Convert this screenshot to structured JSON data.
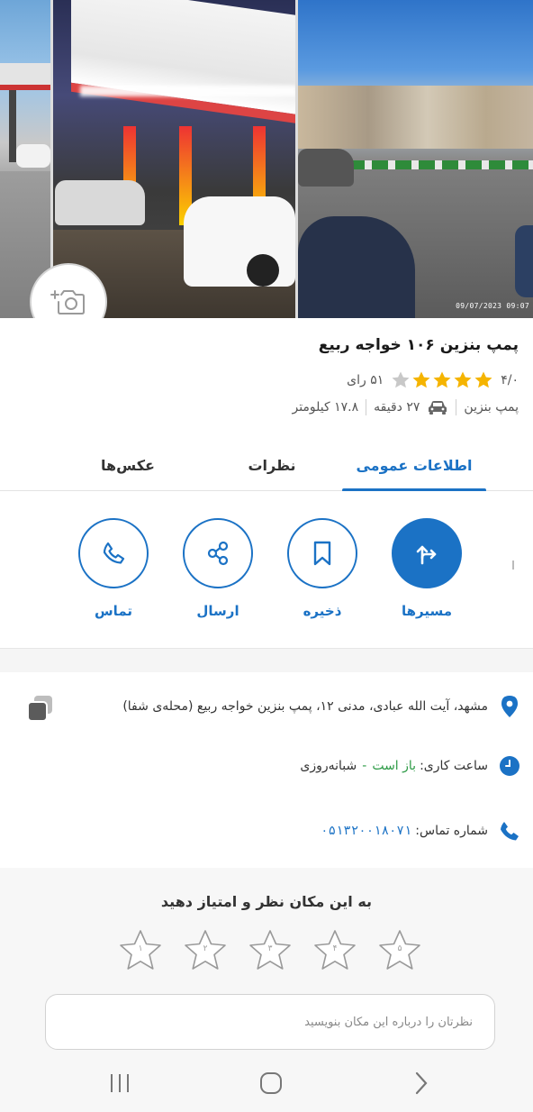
{
  "gallery": {
    "photo_timestamp": "09/07/2023  09:07",
    "add_photo_icon": "camera-plus-icon"
  },
  "place": {
    "title": "پمپ بنزین ۱۰۶ خواجه ربیع",
    "rating_value": "۴/۰",
    "rating_stars": 4,
    "rating_count": "۵۱ رای",
    "category": "پمپ بنزین",
    "drive_time": "۲۷ دقیقه",
    "distance": "۱۷.۸ کیلومتر"
  },
  "tabs": [
    {
      "label": "اطلاعات عمومی",
      "active": true
    },
    {
      "label": "نظرات",
      "active": false
    },
    {
      "label": "عکس‌ها",
      "active": false
    }
  ],
  "actions": [
    {
      "label": "مسیرها",
      "icon": "directions-icon",
      "primary": true
    },
    {
      "label": "ذخیره",
      "icon": "bookmark-icon",
      "primary": false
    },
    {
      "label": "ارسال",
      "icon": "share-icon",
      "primary": false
    },
    {
      "label": "تماس",
      "icon": "phone-icon",
      "primary": false
    }
  ],
  "details": {
    "address": "مشهد، آیت الله عبادی، مدنی ۱۲، پمپ بنزین خواجه ربیع (محله‌ی شفا)",
    "hours_label": "ساعت کاری:",
    "hours_status": "باز است",
    "hours_dash": "-",
    "hours_value": "شبانه‌روزی",
    "phone_label": "شماره تماس:",
    "phone_value": "۰۵۱۳۲۰۰۱۸۰۷۱"
  },
  "review": {
    "title": "به این مکان نظر و امتیاز دهید",
    "stars": [
      "۱",
      "۲",
      "۳",
      "۴",
      "۵"
    ],
    "placeholder": "نظرتان را درباره این مکان بنویسید"
  },
  "colors": {
    "accent": "#1b72c5",
    "star_filled": "#f5b400",
    "star_empty": "#c8c8c8",
    "open": "#2e9b47"
  }
}
